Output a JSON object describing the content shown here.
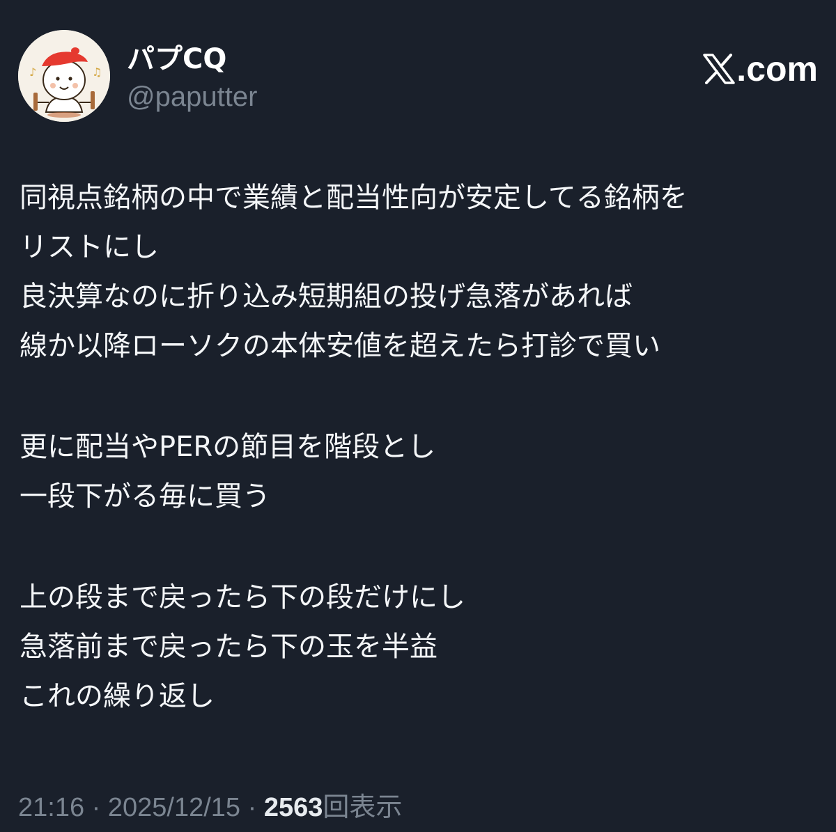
{
  "author": {
    "display_name": "パプCQ",
    "handle": "@paputter"
  },
  "brand": {
    "text": ".com",
    "icon": "x-logo-icon"
  },
  "post": {
    "lines": [
      "同視点銘柄の中で業績と配当性向が安定してる銘柄を",
      "リストにし",
      "良決算なのに折り込み短期組の投げ急落があれば",
      "線か以降ローソクの本体安値を超えたら打診で買い",
      "",
      "更に配当やPERの節目を階段とし",
      "一段下がる毎に買う",
      "",
      "上の段まで戻ったら下の段だけにし",
      "急落前まで戻ったら下の玉を半益",
      "これの繰り返し"
    ]
  },
  "meta": {
    "time": "21:16",
    "separator": " · ",
    "date": "2025/12/15",
    "views": "2563",
    "views_label": "回表示"
  },
  "colors": {
    "background": "#1a202b",
    "text": "#f4f6f8",
    "muted": "#7b8591"
  }
}
